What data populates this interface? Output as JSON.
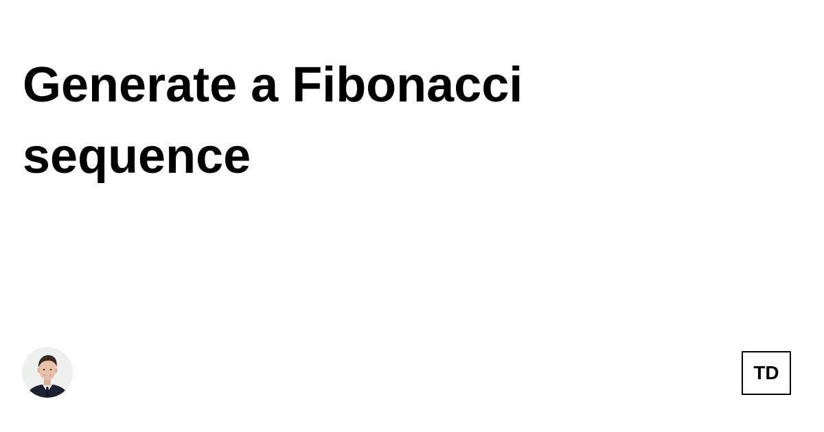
{
  "post": {
    "title": "Generate a Fibonacci sequence"
  },
  "author": {
    "avatar_icon": "author-avatar-photo"
  },
  "publication": {
    "logo_text": "TD"
  },
  "colors": {
    "background": "#ffffff",
    "text": "#000000",
    "suit": "#1c2233",
    "skin": "#e8c2a8",
    "hair": "#3a2a22"
  }
}
